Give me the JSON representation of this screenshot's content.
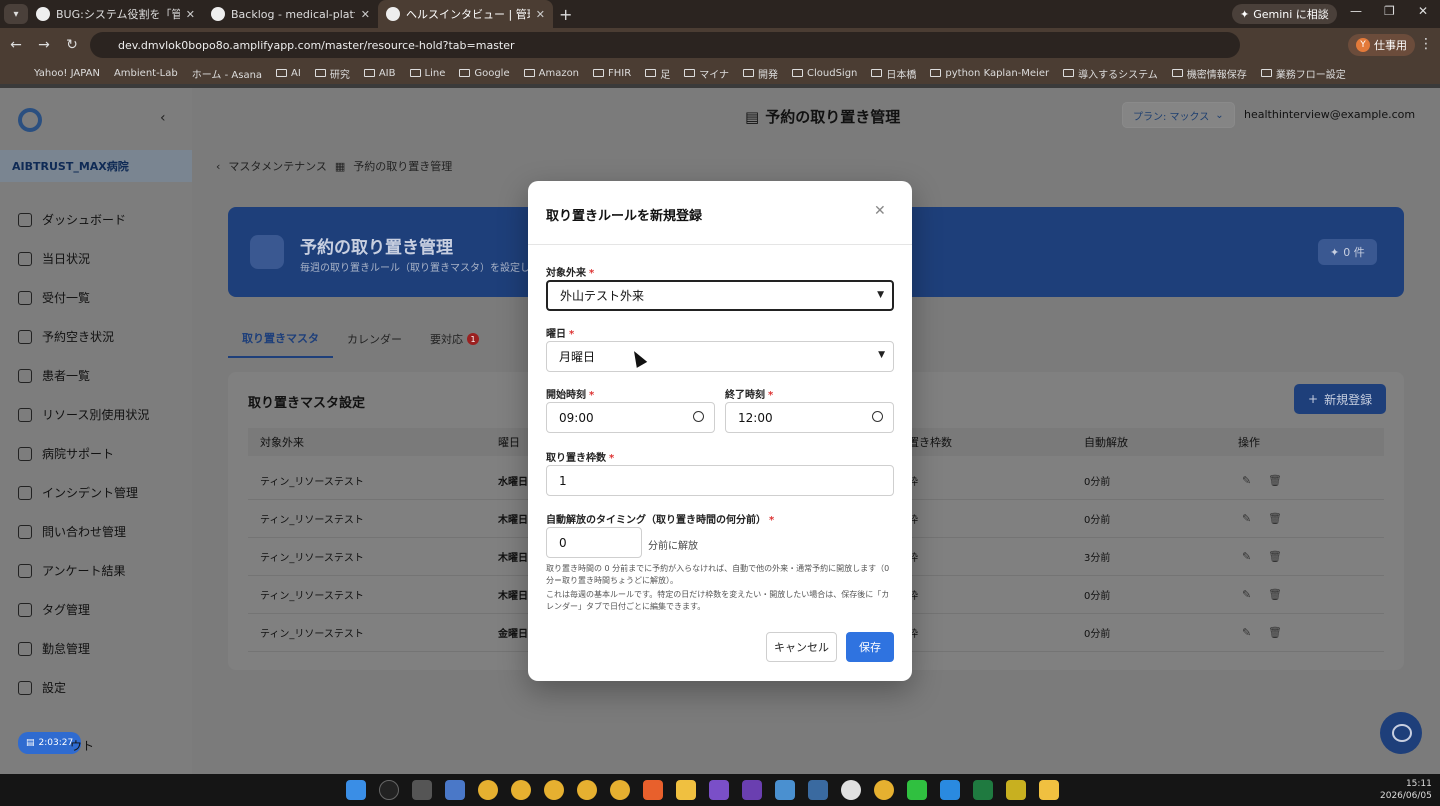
{
  "browser": {
    "tabs": [
      {
        "title": "BUG:システム役割を「管理者ユーザ"
      },
      {
        "title": "Backlog - medical-platform"
      },
      {
        "title": "ヘルスインタビュー | 管理システム"
      }
    ],
    "gemini_label": "Gemini に相談",
    "url": "dev.dmvlok0bopo8o.amplifyapp.com/master/resource-hold?tab=master",
    "profile_label": "仕事用",
    "profile_initial": "Y",
    "bookmarks": [
      "Yahoo! JAPAN",
      "Ambient-Lab",
      "ホーム - Asana",
      "AI",
      "研究",
      "AIB",
      "Line",
      "Google",
      "Amazon",
      "FHIR",
      "足",
      "マイナ",
      "開発",
      "CloudSign",
      "日本橋",
      "python Kaplan-Meier",
      "導入するシステム",
      "機密情報保存",
      "業務フロー設定"
    ]
  },
  "sidebar": {
    "hospital": "AIBTRUST_MAX病院",
    "items": [
      {
        "label": "ダッシュボード"
      },
      {
        "label": "当日状況"
      },
      {
        "label": "受付一覧"
      },
      {
        "label": "予約空き状況"
      },
      {
        "label": "患者一覧"
      },
      {
        "label": "リソース別使用状況"
      },
      {
        "label": "病院サポート"
      },
      {
        "label": "インシデント管理"
      },
      {
        "label": "問い合わせ管理"
      },
      {
        "label": "アンケート結果"
      },
      {
        "label": "タグ管理"
      },
      {
        "label": "勤怠管理"
      },
      {
        "label": "設定"
      }
    ],
    "timer": "2:03:27",
    "logout_partial": "ウト"
  },
  "header": {
    "title": "予約の取り置き管理",
    "plan": "プラン: マックス",
    "user": "healthinterview@example.com"
  },
  "breadcrumb": {
    "parent": "マスタメンテナンス",
    "current": "予約の取り置き管理"
  },
  "hero": {
    "title": "予約の取り置き管理",
    "subtitle": "毎週の取り置きルール（取り置きマスタ）を設定しま",
    "badge": "0 件"
  },
  "tabs": [
    {
      "label": "取り置きマスタ"
    },
    {
      "label": "カレンダー"
    },
    {
      "label": "要対応",
      "count": "1"
    }
  ],
  "card": {
    "title": "取り置きマスタ設定",
    "new_button": "新規登録",
    "columns": {
      "target": "対象外来",
      "weekday": "曜日",
      "slots": "置き枠数",
      "auto_release": "自動解放",
      "actions": "操作"
    },
    "rows": [
      {
        "target": "ティン_リソーステスト",
        "weekday": "水曜日",
        "slots": "枠",
        "auto_release": "0分前"
      },
      {
        "target": "ティン_リソーステスト",
        "weekday": "木曜日",
        "slots": "枠",
        "auto_release": "0分前"
      },
      {
        "target": "ティン_リソーステスト",
        "weekday": "木曜日",
        "slots": "枠",
        "auto_release": "3分前"
      },
      {
        "target": "ティン_リソーステスト",
        "weekday": "木曜日",
        "slots": "枠",
        "auto_release": "0分前"
      },
      {
        "target": "ティン_リソーステスト",
        "weekday": "金曜日",
        "slots": "枠",
        "auto_release": "0分前"
      }
    ]
  },
  "modal": {
    "title": "取り置きルールを新規登録",
    "target_label": "対象外来",
    "target_value": "外山テスト外来",
    "weekday_label": "曜日",
    "weekday_value": "月曜日",
    "start_label": "開始時刻",
    "start_value": "09:00",
    "end_label": "終了時刻",
    "end_value": "12:00",
    "slots_label": "取り置き枠数",
    "slots_value": "1",
    "release_label": "自動解放のタイミング（取り置き時間の何分前）",
    "release_value": "0",
    "release_suffix": "分前に解放",
    "help1": "取り置き時間の 0 分前までに予約が入らなければ、自動で他の外来・通常予約に開放します（0 分＝取り置き時間ちょうどに解放）。",
    "help2": "これは毎週の基本ルールです。特定の日だけ枠数を変えたい・開放したい場合は、保存後に「カレンダー」タブで日付ごとに編集できます。",
    "required_mark": "*",
    "cancel": "キャンセル",
    "save": "保存"
  },
  "taskbar": {
    "time": "15:11",
    "date": "2026/06/05"
  }
}
